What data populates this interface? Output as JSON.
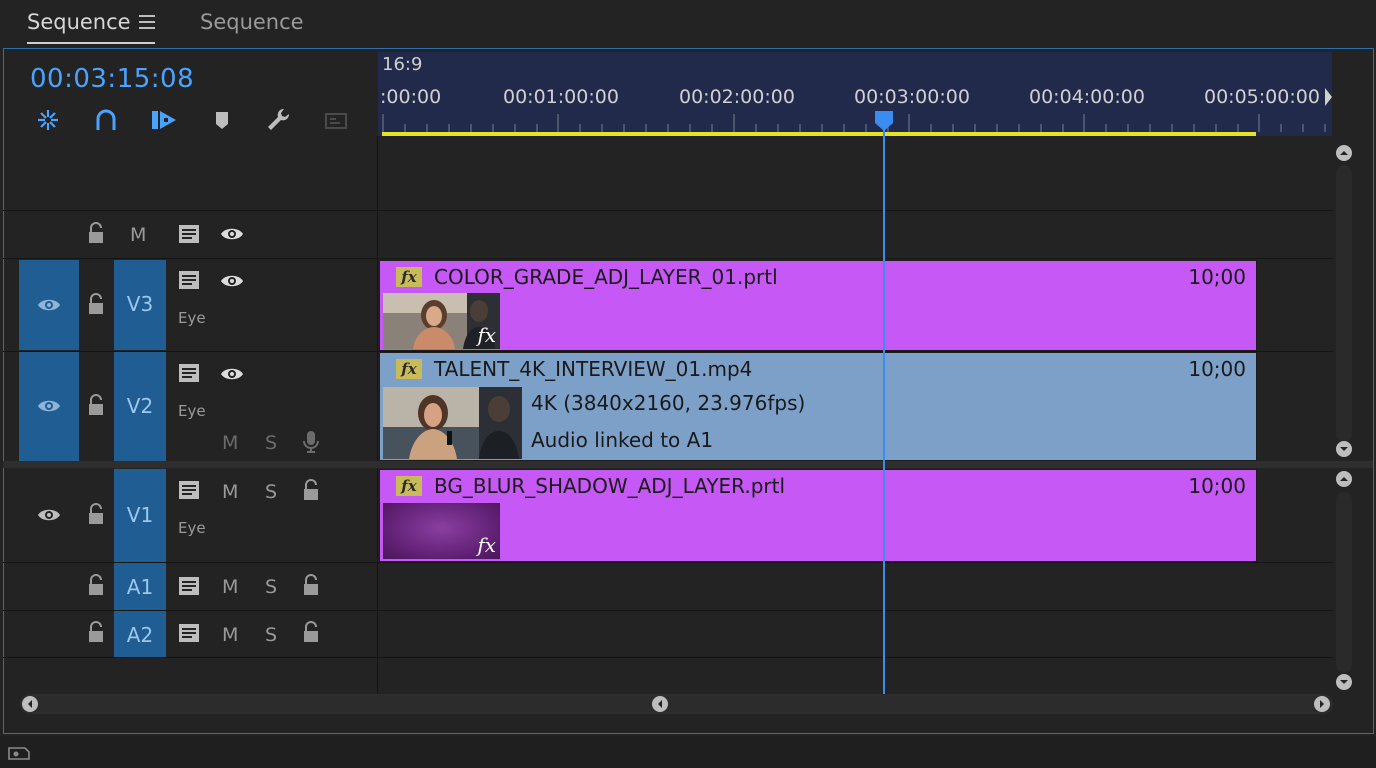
{
  "tabs": {
    "active": "Sequence",
    "inactive": "Sequence"
  },
  "timecode": "00:03:15:08",
  "toolbar": {
    "icons": [
      "nest-icon",
      "snap-icon",
      "linked-selection-icon",
      "marker-icon",
      "wrench-icon",
      "captions-icon"
    ]
  },
  "ruler": {
    "aspect": "16:9",
    "labels": [
      ":00:00",
      "00:01:00:00",
      "00:02:00:00",
      "00:03:00:00",
      "00:04:00:00",
      "00:05:00:00"
    ]
  },
  "tracks": {
    "top": {
      "m": "M"
    },
    "v3": {
      "name": "V3",
      "eye_label": "Eye"
    },
    "v2": {
      "name": "V2",
      "eye_label": "Eye",
      "m": "M",
      "s": "S"
    },
    "v1": {
      "name": "V1",
      "eye_label": "Eye",
      "m": "M",
      "s": "S"
    },
    "a1": {
      "name": "A1",
      "m": "M",
      "s": "S"
    },
    "a2": {
      "name": "A2",
      "m": "M",
      "s": "S"
    }
  },
  "clips": {
    "v3": {
      "fx": "fx",
      "name": "COLOR_GRADE_ADJ_LAYER_01.prtl",
      "duration": "10;00",
      "thumb_fx": "fx"
    },
    "v2": {
      "fx": "fx",
      "name": "TALENT_4K_INTERVIEW_01.mp4",
      "duration": "10;00",
      "info1": "4K (3840x2160, 23.976fps)",
      "info2": "Audio linked to A1"
    },
    "v1": {
      "fx": "fx",
      "name": "BG_BLUR_SHADOW_ADJ_LAYER.prtl",
      "duration": "10;00",
      "thumb_fx": "fx"
    }
  },
  "colors": {
    "accent": "#4aa3ff",
    "track_selected": "#1f5d92",
    "clip_adjustment": "#c658f5",
    "clip_video": "#7ca0c8",
    "work_area": "#e5e22a",
    "ruler_bg": "#212a4a"
  }
}
